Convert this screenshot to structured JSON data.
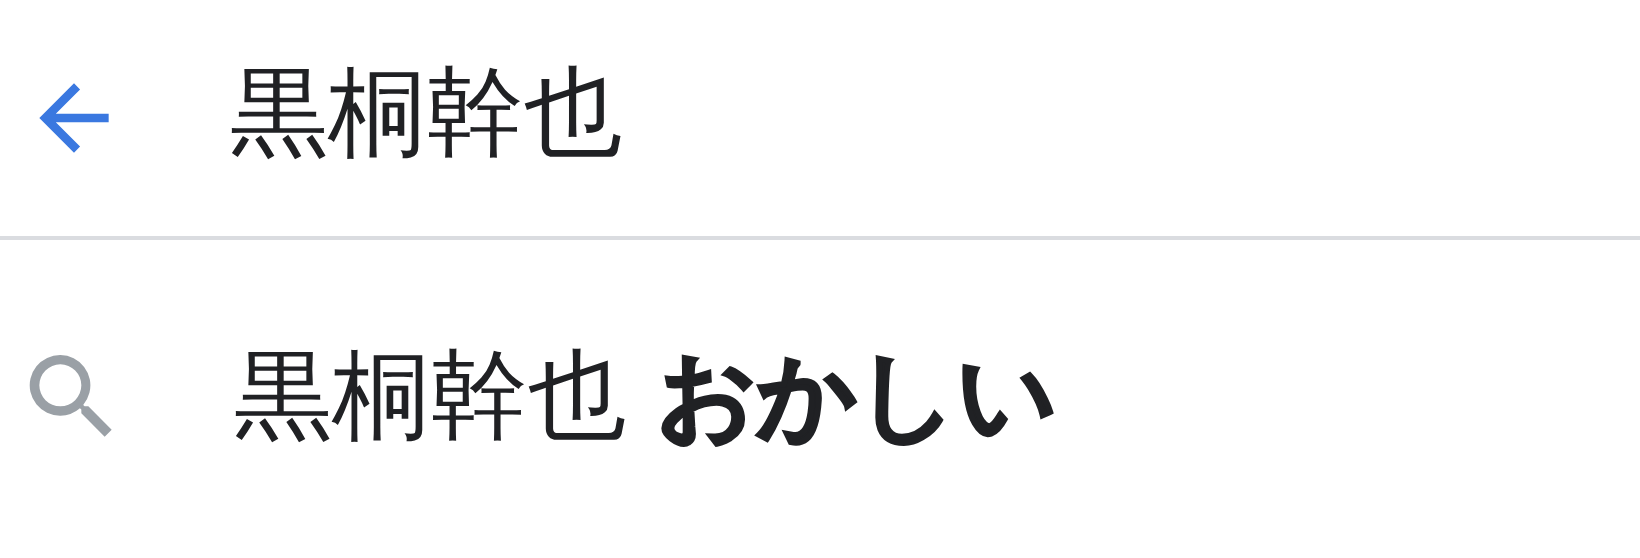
{
  "search": {
    "value": "黒桐幹也"
  },
  "suggestions": [
    {
      "text": "黒桐幹也 **おかしい**"
    }
  ]
}
